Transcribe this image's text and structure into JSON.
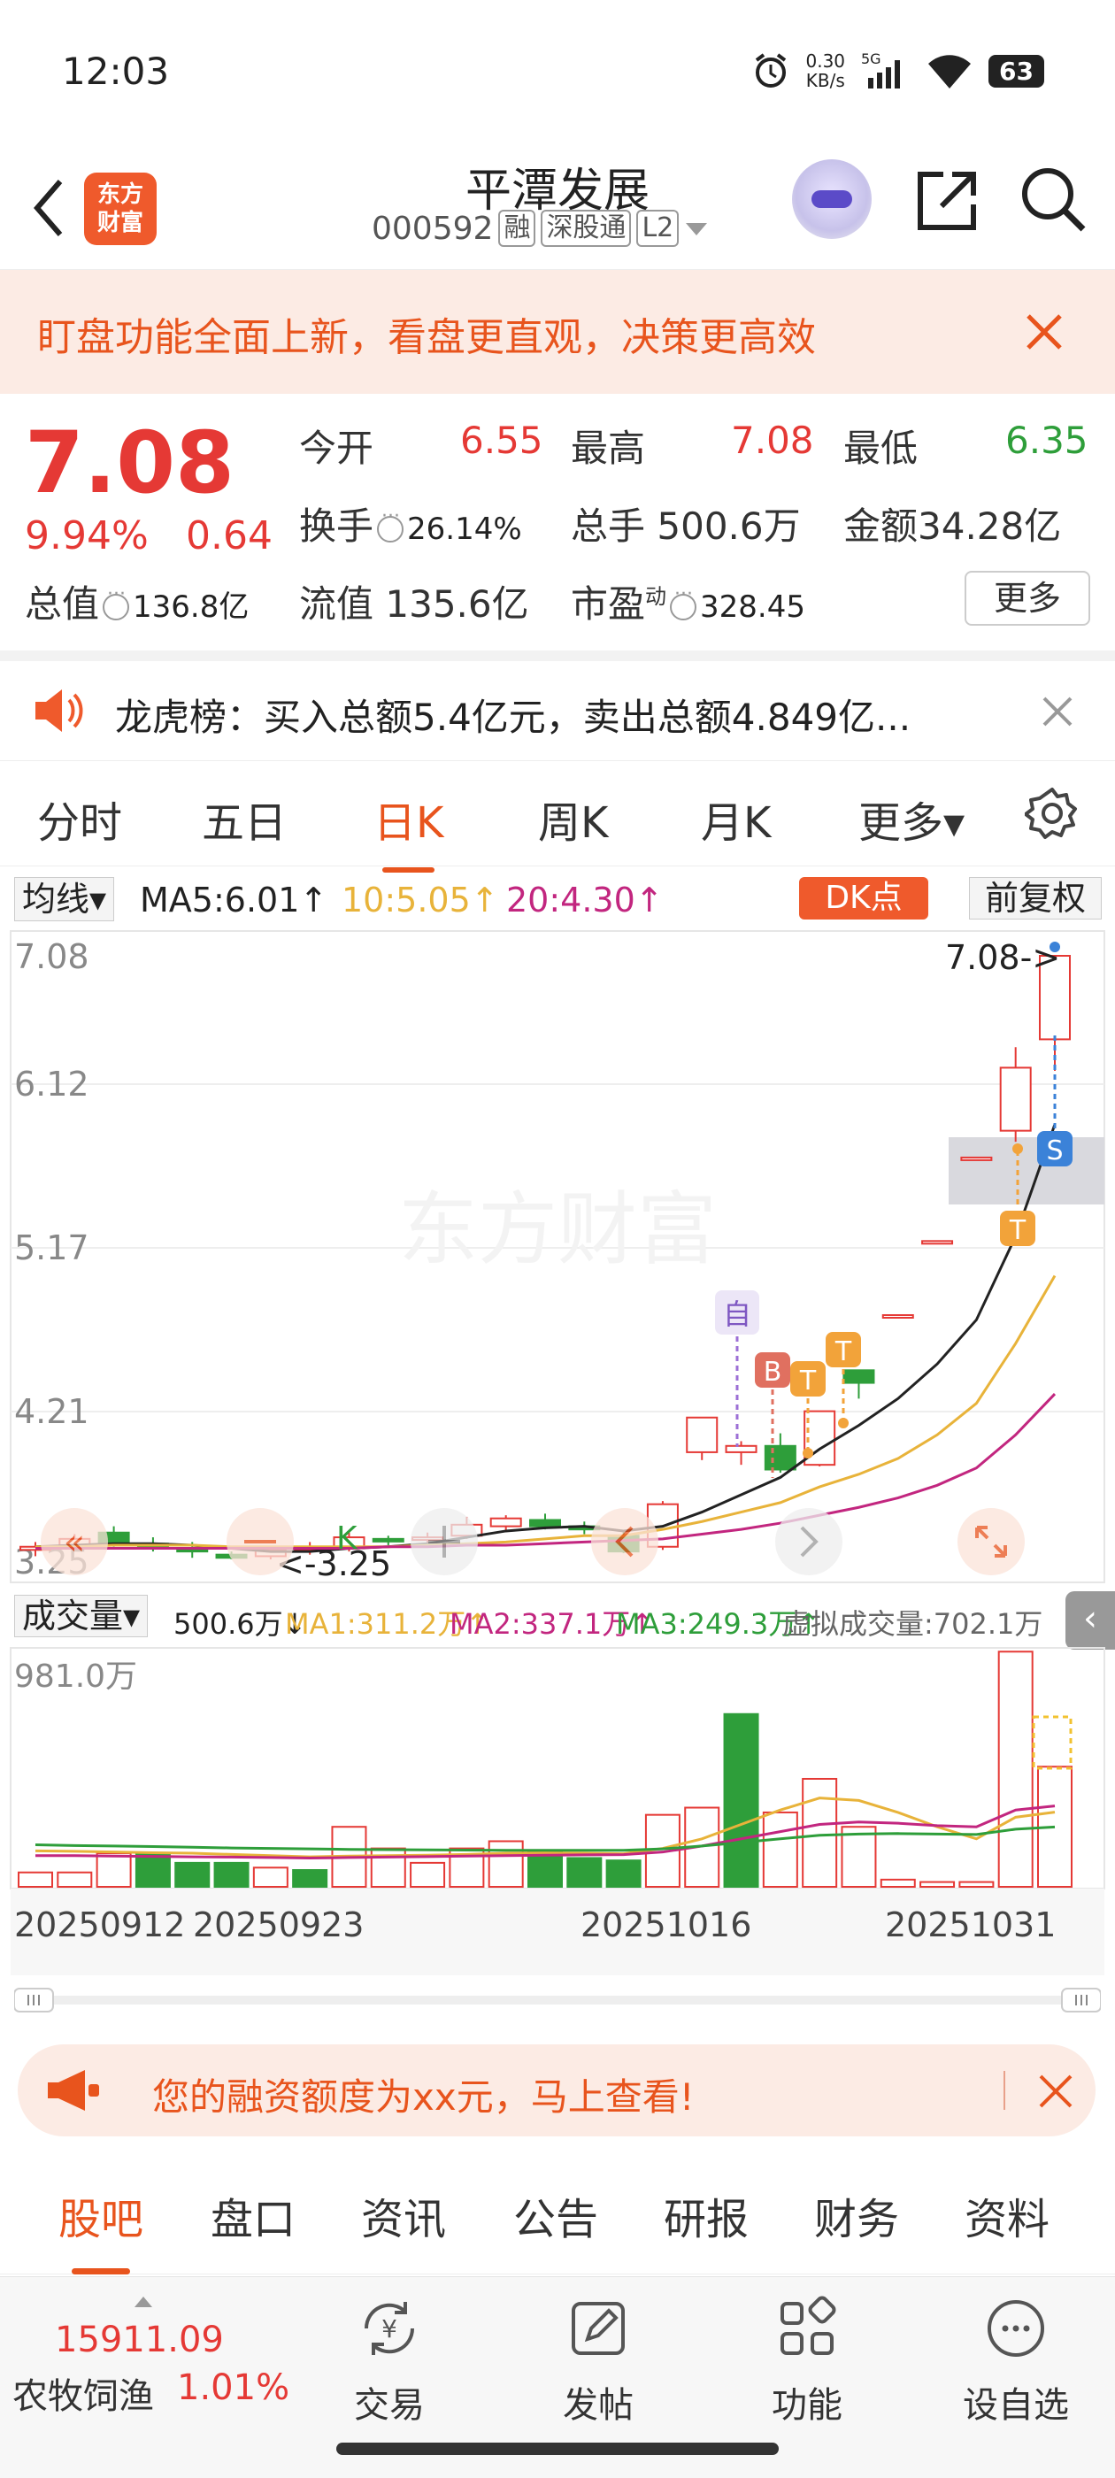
{
  "status_bar": {
    "time": "12:03",
    "speed_value": "0.30",
    "speed_unit": "KB/s",
    "network": "5G",
    "battery": "63"
  },
  "header": {
    "brand_logo_line1": "东方",
    "brand_logo_line2": "财富",
    "stock_name": "平潭发展",
    "stock_code": "000592",
    "tags": [
      "融",
      "深股通",
      "L2"
    ]
  },
  "banner": {
    "text": "盯盘功能全面上新，看盘更直观，决策更高效"
  },
  "quote": {
    "price": "7.08",
    "change_pct": "9.94%",
    "change": "0.64",
    "open_label": "今开",
    "open": "6.55",
    "high_label": "最高",
    "high": "7.08",
    "low_label": "最低",
    "low": "6.35",
    "turnover_label": "换手",
    "turnover": "26.14%",
    "volume_label": "总手",
    "volume": "500.6万",
    "amount_label": "金额",
    "amount": "34.28亿",
    "mktcap_label": "总值",
    "mktcap": "136.8亿",
    "float_label": "流值",
    "float": "135.6亿",
    "pe_label": "市盈",
    "pe_sup": "动",
    "pe": "328.45",
    "more_label": "更多"
  },
  "longhu": {
    "text": "龙虎榜：买入总额5.4亿元，卖出总额4.849亿..."
  },
  "chart_tabs": [
    "分时",
    "五日",
    "日K",
    "周K",
    "月K",
    "更多▾"
  ],
  "ma_row": {
    "selector": "均线▾",
    "ma5": "MA5:6.01↑",
    "ma10": "10:5.05↑",
    "ma20": "20:4.30↑",
    "dk_button": "DK点",
    "fq_button": "前复权"
  },
  "colors": {
    "accent": "#e8541d",
    "up": "#e53935",
    "down": "#2e9e3a",
    "ma5": "#222222",
    "ma10": "#e8b33a",
    "ma20": "#c2267f"
  },
  "chart_labels": {
    "y_ticks": [
      "7.08",
      "6.12",
      "5.17",
      "4.21",
      "3.25"
    ],
    "max_marker": "7.08->",
    "min_marker": "<-3.25",
    "watermark": "东方财富",
    "self_marker": "自",
    "b_marker": "B",
    "t_marker": "T",
    "s_marker": "S",
    "k_marker": "K"
  },
  "volume": {
    "selector": "成交量▾",
    "value": "500.6万↓",
    "ma1": "MA1:311.2万↑",
    "ma2": "MA2:337.1万↑",
    "ma3": "MA3:249.3万↑",
    "virtual": "虚拟成交量:702.1万",
    "y_max": "981.0万",
    "dates": [
      "20250912",
      "20250923",
      "20251016",
      "20251031"
    ]
  },
  "chart_data": [
    {
      "type": "candlestick",
      "title": "",
      "ylim": [
        3.25,
        7.08
      ],
      "y_ticks": [
        7.08,
        6.12,
        5.17,
        4.21,
        3.25
      ],
      "candles": [
        {
          "o": 3.31,
          "h": 3.36,
          "l": 3.27,
          "c": 3.33
        },
        {
          "o": 3.34,
          "h": 3.41,
          "l": 3.31,
          "c": 3.38
        },
        {
          "o": 3.42,
          "h": 3.46,
          "l": 3.33,
          "c": 3.35
        },
        {
          "o": 3.35,
          "h": 3.39,
          "l": 3.3,
          "c": 3.32
        },
        {
          "o": 3.32,
          "h": 3.36,
          "l": 3.26,
          "c": 3.3
        },
        {
          "o": 3.28,
          "h": 3.3,
          "l": 3.25,
          "c": 3.26
        },
        {
          "o": 3.27,
          "h": 3.33,
          "l": 3.25,
          "c": 3.31
        },
        {
          "o": 3.31,
          "h": 3.36,
          "l": 3.28,
          "c": 3.33
        },
        {
          "o": 3.32,
          "h": 3.42,
          "l": 3.3,
          "c": 3.39
        },
        {
          "o": 3.38,
          "h": 3.4,
          "l": 3.34,
          "c": 3.37
        },
        {
          "o": 3.38,
          "h": 3.42,
          "l": 3.35,
          "c": 3.39
        },
        {
          "o": 3.4,
          "h": 3.52,
          "l": 3.38,
          "c": 3.47
        },
        {
          "o": 3.46,
          "h": 3.53,
          "l": 3.43,
          "c": 3.51
        },
        {
          "o": 3.5,
          "h": 3.54,
          "l": 3.44,
          "c": 3.46
        },
        {
          "o": 3.46,
          "h": 3.49,
          "l": 3.41,
          "c": 3.44
        },
        {
          "o": 3.4,
          "h": 3.43,
          "l": 3.29,
          "c": 3.3
        },
        {
          "o": 3.33,
          "h": 3.62,
          "l": 3.31,
          "c": 3.6
        },
        {
          "o": 3.93,
          "h": 4.15,
          "l": 3.88,
          "c": 4.15
        },
        {
          "o": 3.93,
          "h": 4.0,
          "l": 3.85,
          "c": 3.97
        },
        {
          "o": 3.97,
          "h": 4.05,
          "l": 3.8,
          "c": 3.82
        },
        {
          "o": 3.85,
          "h": 4.19,
          "l": 3.84,
          "c": 4.19
        },
        {
          "o": 4.45,
          "h": 4.45,
          "l": 4.27,
          "c": 4.37
        },
        {
          "o": 4.8,
          "h": 4.8,
          "l": 4.8,
          "c": 4.8
        },
        {
          "o": 5.27,
          "h": 5.27,
          "l": 5.27,
          "c": 5.27
        },
        {
          "o": 5.8,
          "h": 5.8,
          "l": 5.8,
          "c": 5.8
        },
        {
          "o": 5.97,
          "h": 6.5,
          "l": 5.9,
          "c": 6.37
        },
        {
          "o": 6.55,
          "h": 7.08,
          "l": 6.35,
          "c": 7.08
        }
      ],
      "ma5": [
        3.33,
        3.34,
        3.35,
        3.35,
        3.34,
        3.32,
        3.3,
        3.3,
        3.32,
        3.33,
        3.35,
        3.39,
        3.43,
        3.45,
        3.46,
        3.43,
        3.46,
        3.55,
        3.66,
        3.77,
        3.95,
        4.1,
        4.27,
        4.49,
        4.77,
        5.3,
        6.01
      ],
      "ma10": [
        3.33,
        3.33,
        3.34,
        3.34,
        3.34,
        3.33,
        3.33,
        3.33,
        3.33,
        3.33,
        3.34,
        3.35,
        3.36,
        3.38,
        3.4,
        3.4,
        3.44,
        3.49,
        3.55,
        3.61,
        3.71,
        3.79,
        3.89,
        4.04,
        4.24,
        4.62,
        5.05
      ],
      "ma20": [
        3.32,
        3.32,
        3.32,
        3.32,
        3.32,
        3.32,
        3.32,
        3.32,
        3.32,
        3.33,
        3.33,
        3.34,
        3.34,
        3.35,
        3.36,
        3.37,
        3.38,
        3.41,
        3.44,
        3.48,
        3.53,
        3.58,
        3.64,
        3.72,
        3.83,
        4.04,
        4.3
      ]
    },
    {
      "type": "bar",
      "title": "成交量",
      "ylim": [
        0,
        981.0
      ],
      "unit": "万",
      "values": [
        60,
        60,
        140,
        140,
        100,
        100,
        80,
        70,
        250,
        160,
        100,
        160,
        190,
        150,
        120,
        110,
        300,
        330,
        720,
        310,
        450,
        250,
        30,
        20,
        20,
        980,
        500.6
      ],
      "up": [
        true,
        true,
        true,
        false,
        false,
        false,
        true,
        false,
        true,
        true,
        true,
        true,
        true,
        false,
        false,
        false,
        true,
        true,
        false,
        true,
        true,
        true,
        true,
        true,
        true,
        true,
        true
      ],
      "ma1": [
        150,
        148,
        145,
        142,
        140,
        135,
        130,
        125,
        128,
        130,
        132,
        135,
        140,
        142,
        140,
        138,
        160,
        200,
        260,
        320,
        370,
        360,
        310,
        250,
        200,
        290,
        311.2
      ],
      "ma2": [
        130,
        130,
        128,
        127,
        125,
        124,
        122,
        120,
        122,
        124,
        126,
        128,
        130,
        132,
        133,
        134,
        145,
        170,
        200,
        230,
        260,
        270,
        265,
        255,
        250,
        320,
        337.1
      ],
      "ma3": [
        175,
        172,
        170,
        168,
        165,
        162,
        160,
        158,
        156,
        155,
        154,
        153,
        152,
        152,
        152,
        152,
        158,
        170,
        185,
        200,
        215,
        220,
        222,
        220,
        218,
        240,
        249.3
      ]
    }
  ],
  "financing_banner": {
    "text": "您的融资额度为xx元，马上查看!"
  },
  "bottom_tabs": [
    "股吧",
    "盘口",
    "资讯",
    "公告",
    "研报",
    "财务",
    "资料"
  ],
  "bottom_nav": {
    "index_value": "15911.09",
    "index_name": "农牧饲渔",
    "index_pct": "1.01%",
    "items": [
      "交易",
      "发帖",
      "功能",
      "设自选"
    ]
  }
}
